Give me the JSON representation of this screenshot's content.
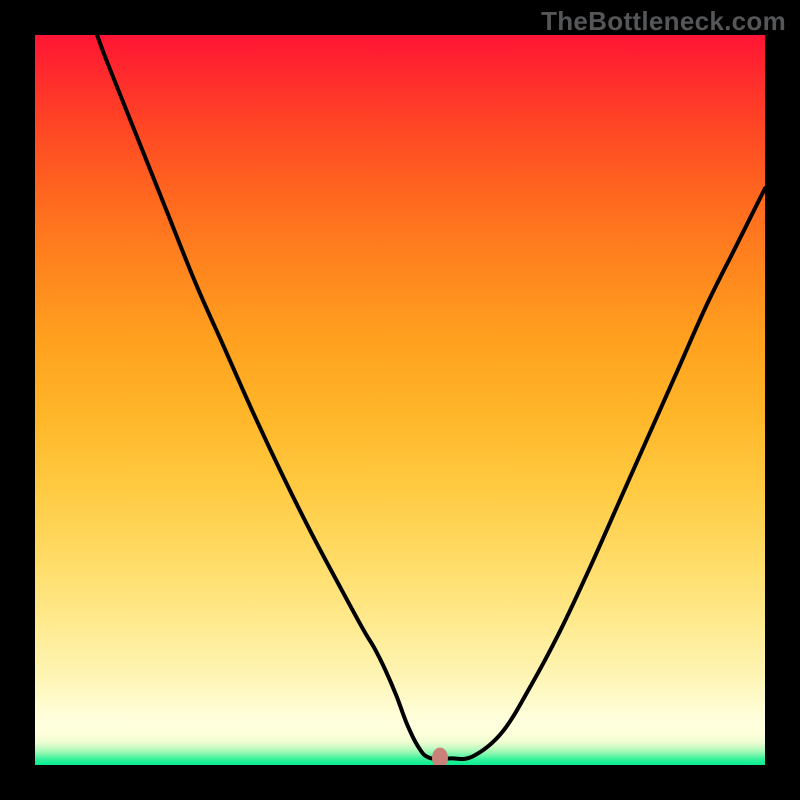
{
  "watermark": "TheBottleneck.com",
  "chart_data": {
    "type": "line",
    "title": "",
    "xlabel": "",
    "ylabel": "",
    "xlim": [
      0,
      100
    ],
    "ylim": [
      0,
      100
    ],
    "grid": false,
    "series": [
      {
        "name": "bottleneck-curve",
        "color": "#000000",
        "x": [
          8.5,
          10,
          14,
          18,
          22,
          26,
          30,
          34,
          38,
          42,
          45,
          46.5,
          48,
          49.5,
          51,
          52.5,
          54,
          57,
          60,
          64,
          68,
          72,
          76,
          80,
          84,
          88,
          92,
          96,
          100
        ],
        "y": [
          100,
          96,
          86,
          76,
          66,
          57,
          48,
          39.5,
          31.5,
          24,
          18.5,
          16,
          13,
          9.5,
          5.5,
          2.5,
          1.0,
          0.9,
          1.2,
          4.5,
          11,
          18.5,
          27,
          36,
          45,
          54,
          63,
          71,
          79
        ]
      }
    ],
    "marker": {
      "x": 55.5,
      "y": 1.0,
      "color": "#c98179"
    },
    "green_band_top": 4.2
  }
}
